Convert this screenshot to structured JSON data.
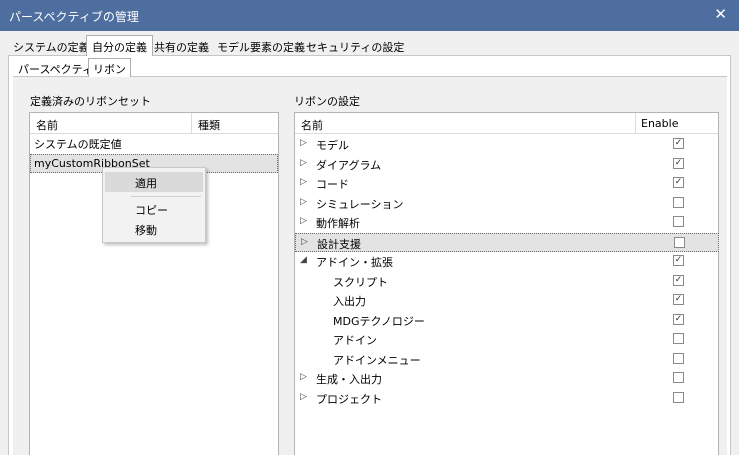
{
  "window": {
    "title": "パースペクティブの管理",
    "close_glyph": "✕"
  },
  "tabs_top": [
    {
      "label": "システムの定義",
      "active": false
    },
    {
      "label": "自分の定義",
      "active": true
    },
    {
      "label": "共有の定義",
      "active": false
    },
    {
      "label": "モデル要素の定義",
      "active": false
    },
    {
      "label": "セキュリティの設定",
      "active": false
    }
  ],
  "tabs_sub": [
    {
      "label": "パースペクティブ",
      "active": false
    },
    {
      "label": "リボン",
      "active": true
    }
  ],
  "left_panel": {
    "label": "定義済みのリボンセット",
    "columns": [
      "名前",
      "種類"
    ],
    "rows": [
      {
        "name": "システムの既定値",
        "type": ""
      },
      {
        "name": "myCustomRibbonSet",
        "type": "",
        "selected": true
      }
    ]
  },
  "context_menu": {
    "items": [
      "適用",
      "コピー",
      "移動"
    ],
    "highlighted": "適用"
  },
  "right_panel": {
    "label": "リボンの設定",
    "columns": [
      "名前",
      "Enable"
    ],
    "rows": [
      {
        "label": "モデル",
        "expander": "▷",
        "checked": true,
        "indent": 0
      },
      {
        "label": "ダイアグラム",
        "expander": "▷",
        "checked": true,
        "indent": 0
      },
      {
        "label": "コード",
        "expander": "▷",
        "checked": true,
        "indent": 0
      },
      {
        "label": "シミュレーション",
        "expander": "▷",
        "checked": false,
        "indent": 0
      },
      {
        "label": "動作解析",
        "expander": "▷",
        "checked": false,
        "indent": 0
      },
      {
        "label": "設計支援",
        "expander": "▷",
        "checked": false,
        "indent": 0,
        "selected": true
      },
      {
        "label": "アドイン・拡張",
        "expander": "◢",
        "checked": true,
        "indent": 0
      },
      {
        "label": "スクリプト",
        "expander": "",
        "checked": true,
        "indent": 1
      },
      {
        "label": "入出力",
        "expander": "",
        "checked": true,
        "indent": 1
      },
      {
        "label": "MDGテクノロジー",
        "expander": "",
        "checked": true,
        "indent": 1
      },
      {
        "label": "アドイン",
        "expander": "",
        "checked": false,
        "indent": 1
      },
      {
        "label": "アドインメニュー",
        "expander": "",
        "checked": false,
        "indent": 1
      },
      {
        "label": "生成・入出力",
        "expander": "▷",
        "checked": false,
        "indent": 0
      },
      {
        "label": "プロジェクト",
        "expander": "▷",
        "checked": false,
        "indent": 0
      }
    ]
  },
  "colors": {
    "titlebar": "#4f6ea0",
    "selection": "#e3e3e3"
  },
  "check_glyph": "✓"
}
